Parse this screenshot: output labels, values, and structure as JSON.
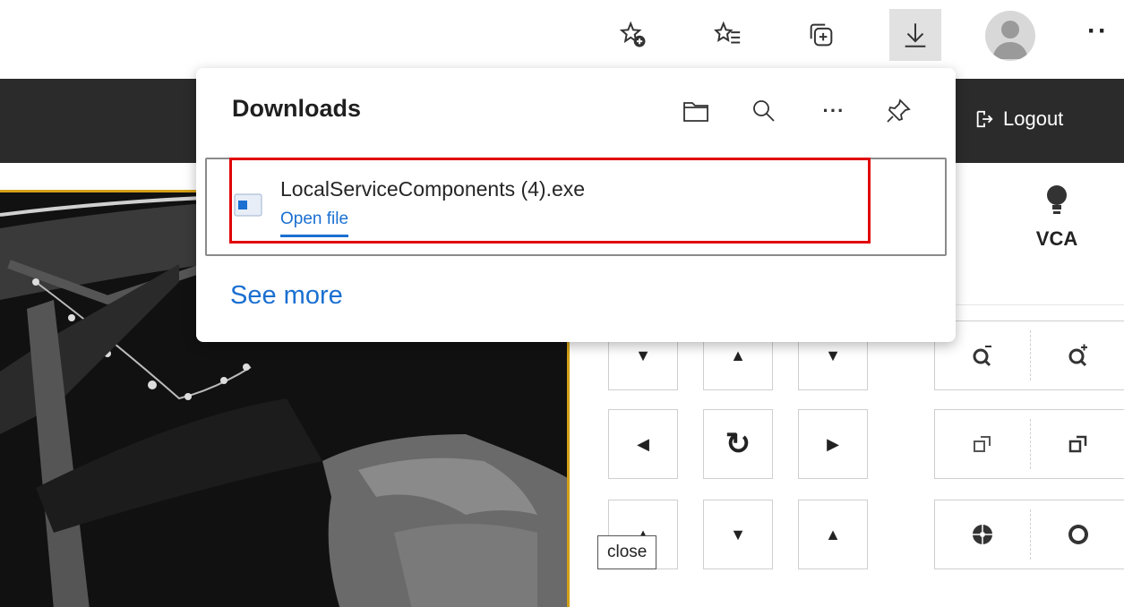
{
  "browser_toolbar": {
    "icons": [
      "add-favorite-icon",
      "favorites-icon",
      "collections-icon",
      "downloads-icon",
      "profile-avatar-icon",
      "more-icon"
    ],
    "more_label": "··"
  },
  "app_header": {
    "logout_label": "Logout"
  },
  "right_panel": {
    "vca_label": "VCA"
  },
  "downloads_flyout": {
    "title": "Downloads",
    "items": [
      {
        "file_name": "LocalServiceComponents (4).exe",
        "action_label": "Open file"
      }
    ],
    "see_more_label": "See more"
  },
  "tooltip": {
    "text": "close"
  },
  "colors": {
    "accent_link": "#1a6fd1",
    "highlight_border": "#e00000",
    "header_bg": "#2b2b2b",
    "video_border": "#d4a017"
  }
}
